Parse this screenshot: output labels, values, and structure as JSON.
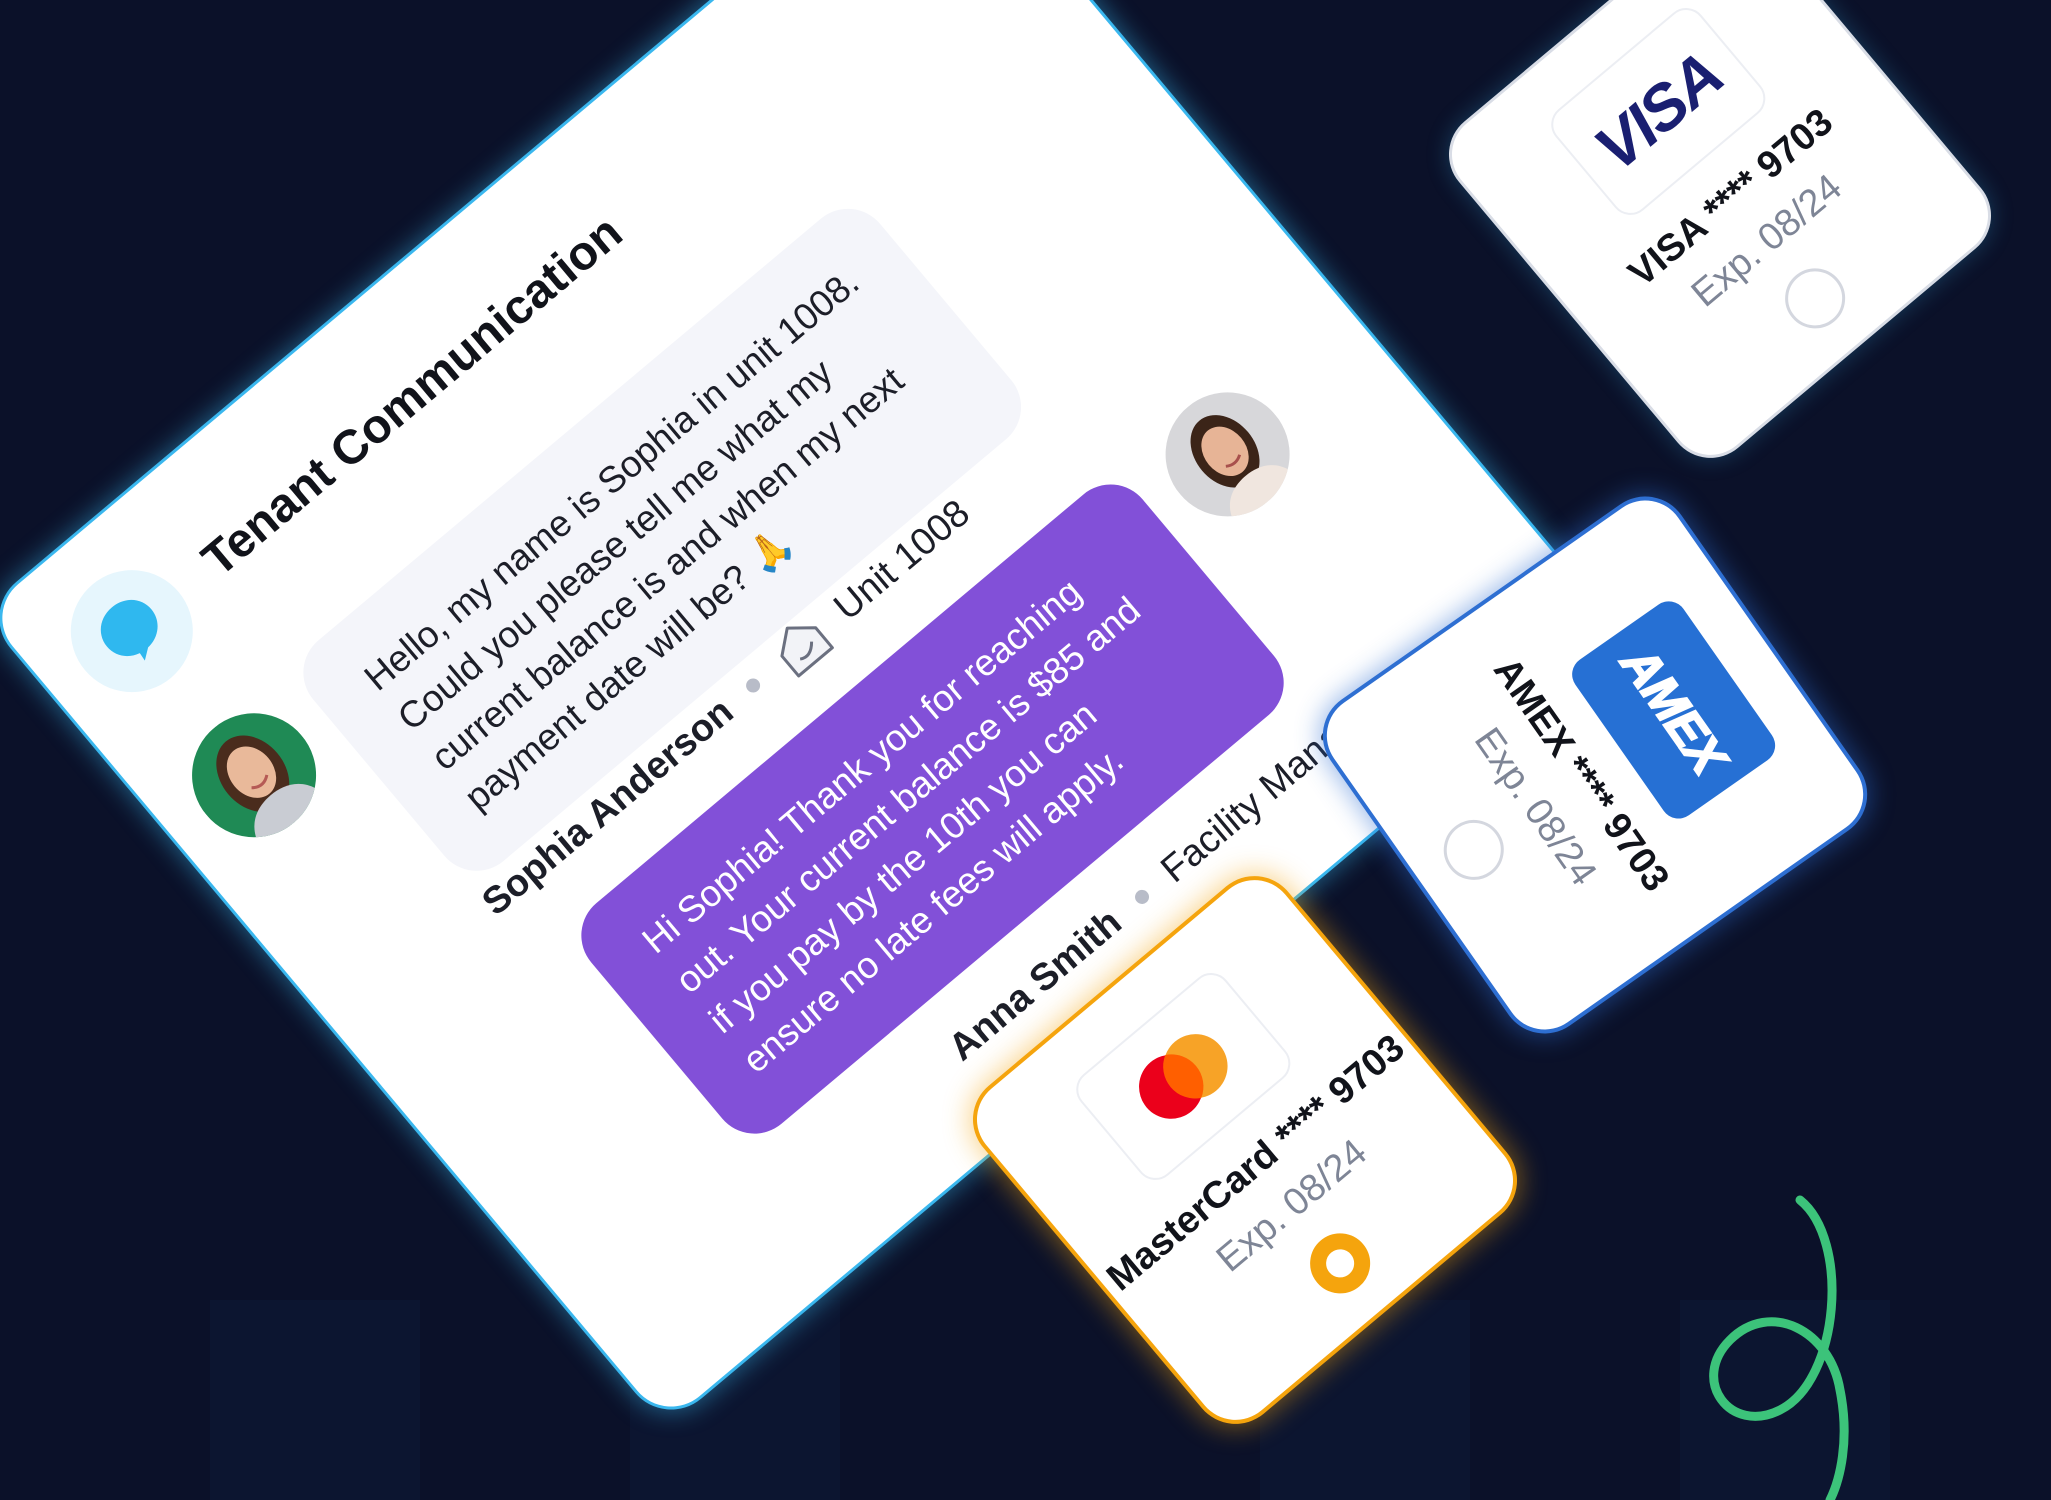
{
  "chat": {
    "title": "Tenant Communication",
    "messages": [
      {
        "text": "Hello, my name is Sophia in unit 1008. Could you please tell me what my current balance is and when my next payment date will be? 🙏",
        "sender": "Sophia Anderson",
        "detail": "Unit 1008",
        "detail_icon": "house-icon"
      },
      {
        "text": "Hi Sophia! Thank you for reaching out. Your current balance is $85 and if you pay by the 10th you can ensure no late fees will apply.",
        "sender": "Anna Smith",
        "detail": "Facility Manager"
      }
    ]
  },
  "payment_cards": [
    {
      "brand": "VISA",
      "logo_text": "VISA",
      "label": "VISA **** 9703",
      "expiry": "Exp. 08/24",
      "selected": false
    },
    {
      "brand": "AMEX",
      "logo_text": "AMEX",
      "label": "AMEX **** 9703",
      "expiry": "Exp. 08/24",
      "selected": false
    },
    {
      "brand": "MasterCard",
      "label": "MasterCard **** 9703",
      "expiry": "Exp. 08/24",
      "selected": true
    }
  ],
  "colors": {
    "background": "#0b1129",
    "card_border": "#3ab7ee",
    "outgoing_bubble": "#8250d8",
    "incoming_bubble": "#f4f5fa",
    "amex_blue": "#2670d4",
    "visa_blue": "#1a1f71",
    "mastercard_red": "#eb001b",
    "mastercard_orange": "#f79e1b",
    "selected_radio": "#f5a40d",
    "spiral_green": "#3cc37a"
  }
}
